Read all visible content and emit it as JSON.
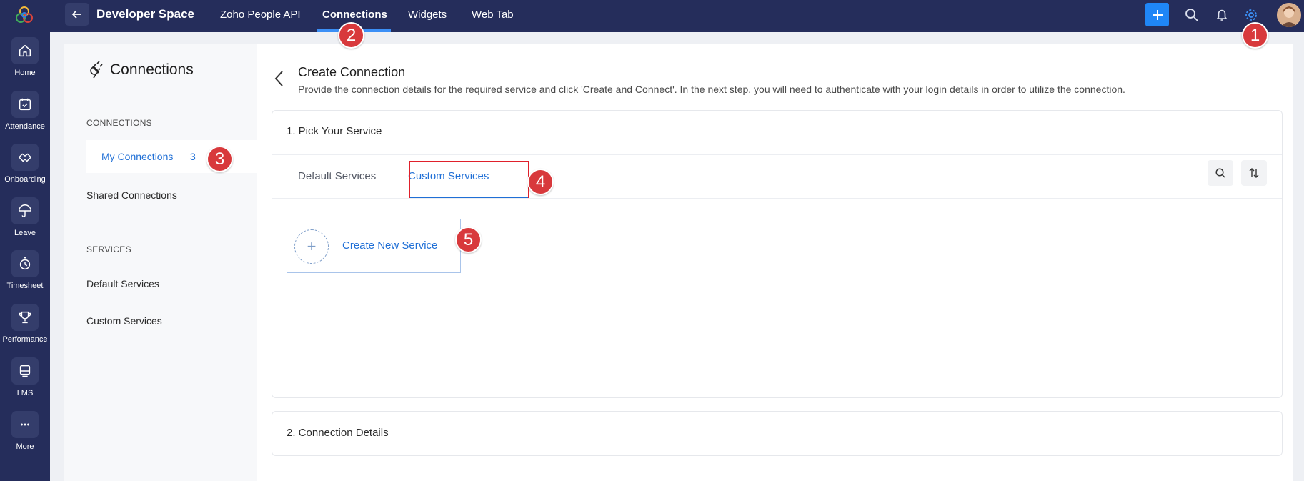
{
  "rail": {
    "items": [
      {
        "label": "Home",
        "icon": "home-icon"
      },
      {
        "label": "Attendance",
        "icon": "calendar-check-icon"
      },
      {
        "label": "Onboarding",
        "icon": "handshake-icon"
      },
      {
        "label": "Leave",
        "icon": "umbrella-icon"
      },
      {
        "label": "Timesheet",
        "icon": "timer-icon"
      },
      {
        "label": "Performance",
        "icon": "trophy-icon"
      },
      {
        "label": "LMS",
        "icon": "lms-icon"
      },
      {
        "label": "More",
        "icon": "more-icon"
      }
    ]
  },
  "topbar": {
    "brand": "Developer Space",
    "tabs": [
      {
        "label": "Zoho People API"
      },
      {
        "label": "Connections"
      },
      {
        "label": "Widgets"
      },
      {
        "label": "Web Tab"
      }
    ]
  },
  "sidebar": {
    "title": "Connections",
    "connections_heading": "CONNECTIONS",
    "my_connections": {
      "label": "My Connections",
      "count": "3"
    },
    "shared_connections": "Shared Connections",
    "services_heading": "SERVICES",
    "default_services": "Default Services",
    "custom_services": "Custom Services"
  },
  "main": {
    "title": "Create Connection",
    "description": "Provide the connection details for the required service and click 'Create and Connect'. In the next step, you will need to authenticate with your login details in order to utilize the connection.",
    "step1": "1. Pick Your Service",
    "tabs": {
      "default": "Default Services",
      "custom": "Custom Services"
    },
    "create_new": "Create New Service",
    "step2": "2. Connection Details"
  },
  "callouts": [
    "1",
    "2",
    "3",
    "4",
    "5"
  ],
  "colors": {
    "nav_bg": "#252d5b",
    "accent": "#1f6fd6",
    "add_button": "#1f86f7",
    "callout": "#d8393c",
    "highlight_box": "#e0202b"
  }
}
